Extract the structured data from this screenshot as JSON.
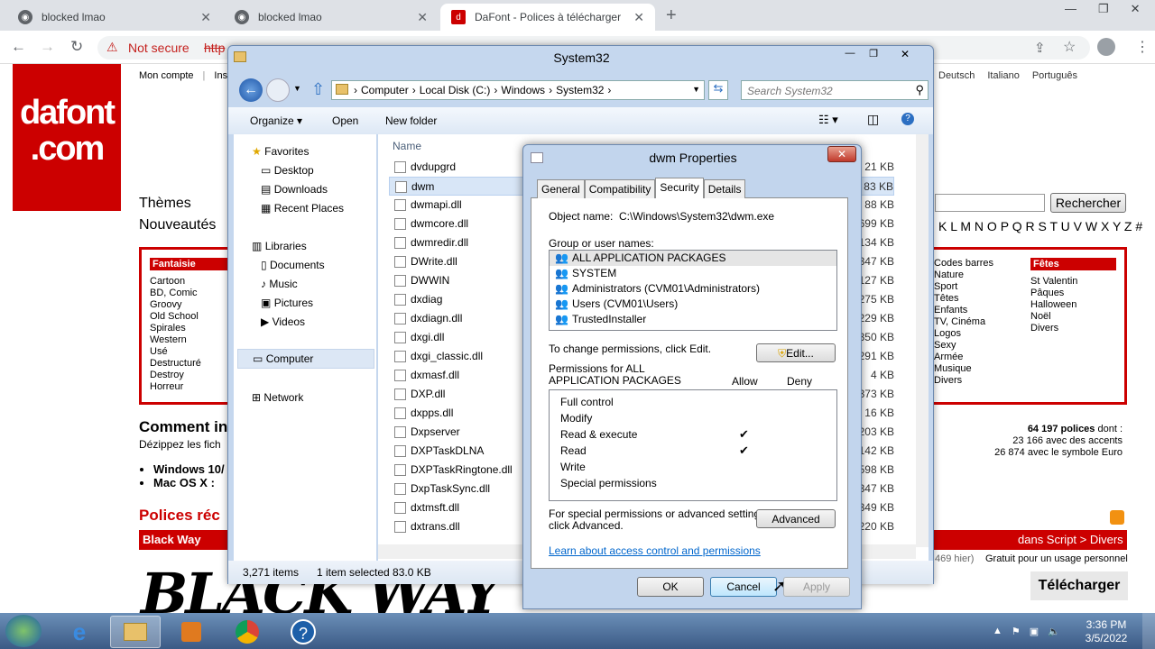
{
  "browser": {
    "tabs": [
      {
        "title": "blocked lmao"
      },
      {
        "title": "blocked lmao"
      },
      {
        "title": "DaFont - Polices à télécharger"
      }
    ],
    "security": "Not secure",
    "url": "http",
    "colors": {
      "tabbar": "#dee1e6",
      "accent": "#cc0000"
    }
  },
  "dafont": {
    "logo_line1": "dafont",
    "logo_line2": ".com",
    "top_links": [
      "Mon compte",
      "Insc"
    ],
    "languages": [
      "Deutsch",
      "Italiano",
      "Português"
    ],
    "nav1": "Thèmes",
    "nav2": "Nouveautés",
    "search_button": "Rechercher",
    "alphabet": "K L M N O P Q R S T U V W X Y Z #",
    "cat_fantaisie_title": "Fantaisie",
    "cat_fantaisie": [
      "Cartoon",
      "BD, Comic",
      "Groovy",
      "Old School",
      "Spirales",
      "Western",
      "Usé",
      "Destructuré",
      "Destroy",
      "Horreur"
    ],
    "cat_misc": [
      "Codes barres",
      "Nature",
      "Sport",
      "Têtes",
      "Enfants",
      "TV, Cinéma",
      "Logos",
      "Sexy",
      "Armée",
      "Musique",
      "Divers"
    ],
    "cat_fetes_title": "Fêtes",
    "cat_fetes": [
      "St Valentin",
      "Pâques",
      "Halloween",
      "Noël",
      "Divers"
    ],
    "comment_title": "Comment in",
    "comment_sub": "Dézippez les fich",
    "os_items": [
      "Windows 10/",
      "Mac OS X :"
    ],
    "stats_count": "64 197 polices",
    "stats_dont": " dont :",
    "stats_line2": "23 166 avec des accents",
    "stats_line3": "26 874 avec le symbole Euro",
    "recent_title": "Polices réc",
    "featured_font": "Black Way",
    "featured_cat": "dans Script > Divers",
    "hits": "469 hier)",
    "license": "Gratuit pour un usage personnel",
    "download": "Télécharger",
    "preview_text": "BLACK WAY"
  },
  "explorer": {
    "title": "System32",
    "breadcrumb": [
      "Computer",
      "Local Disk (C:)",
      "Windows",
      "System32"
    ],
    "search_placeholder": "Search System32",
    "toolbar": {
      "organize": "Organize",
      "open": "Open",
      "new_folder": "New folder"
    },
    "col_name": "Name",
    "sidebar": {
      "favorites": "Favorites",
      "fav_items": [
        "Desktop",
        "Downloads",
        "Recent Places"
      ],
      "libraries": "Libraries",
      "lib_items": [
        "Documents",
        "Music",
        "Pictures",
        "Videos"
      ],
      "computer": "Computer",
      "network": "Network"
    },
    "files": [
      {
        "name": "dvdupgrd",
        "size": "21 KB"
      },
      {
        "name": "dwm",
        "size": "83 KB"
      },
      {
        "name": "dwmapi.dll",
        "size": "88 KB"
      },
      {
        "name": "dwmcore.dll",
        "size": "1,699 KB"
      },
      {
        "name": "dwmredir.dll",
        "size": "134 KB"
      },
      {
        "name": "DWrite.dll",
        "size": "1,347 KB"
      },
      {
        "name": "DWWIN",
        "size": "127 KB"
      },
      {
        "name": "dxdiag",
        "size": "275 KB"
      },
      {
        "name": "dxdiagn.dll",
        "size": "229 KB"
      },
      {
        "name": "dxgi.dll",
        "size": "350 KB"
      },
      {
        "name": "dxgi_classic.dll",
        "size": "291 KB"
      },
      {
        "name": "dxmasf.dll",
        "size": "4 KB"
      },
      {
        "name": "DXP.dll",
        "size": "373 KB"
      },
      {
        "name": "dxpps.dll",
        "size": "16 KB"
      },
      {
        "name": "Dxpserver",
        "size": "203 KB"
      },
      {
        "name": "DXPTaskDLNA",
        "size": "142 KB"
      },
      {
        "name": "DXPTaskRingtone.dll",
        "size": "598 KB"
      },
      {
        "name": "DxpTaskSync.dll",
        "size": "1,347 KB"
      },
      {
        "name": "dxtmsft.dll",
        "size": "349 KB"
      },
      {
        "name": "dxtrans.dll",
        "size": "220 KB"
      }
    ],
    "status_items": "3,271 items",
    "status_selected": "1 item selected  83.0 KB"
  },
  "dialog": {
    "title": "dwm Properties",
    "tabs": [
      "General",
      "Compatibility",
      "Security",
      "Details"
    ],
    "object_label": "Object name:",
    "object_value": "C:\\Windows\\System32\\dwm.exe",
    "group_label": "Group or user names:",
    "users": [
      "ALL APPLICATION PACKAGES",
      "SYSTEM",
      "Administrators (CVM01\\Administrators)",
      "Users (CVM01\\Users)",
      "TrustedInstaller"
    ],
    "change_text": "To change permissions, click Edit.",
    "edit_button": "Edit...",
    "perm_label_1": "Permissions for ALL",
    "perm_label_2": "APPLICATION PACKAGES",
    "allow": "Allow",
    "deny": "Deny",
    "permissions": [
      {
        "name": "Full control",
        "allow": ""
      },
      {
        "name": "Modify",
        "allow": ""
      },
      {
        "name": "Read & execute",
        "allow": "✔"
      },
      {
        "name": "Read",
        "allow": "✔"
      },
      {
        "name": "Write",
        "allow": ""
      },
      {
        "name": "Special permissions",
        "allow": ""
      }
    ],
    "special_text_1": "For special permissions or advanced settings,",
    "special_text_2": "click Advanced.",
    "advanced_button": "Advanced",
    "learn_link": "Learn about access control and permissions",
    "ok": "OK",
    "cancel": "Cancel",
    "apply": "Apply"
  },
  "taskbar": {
    "time": "3:36 PM",
    "date": "3/5/2022"
  }
}
